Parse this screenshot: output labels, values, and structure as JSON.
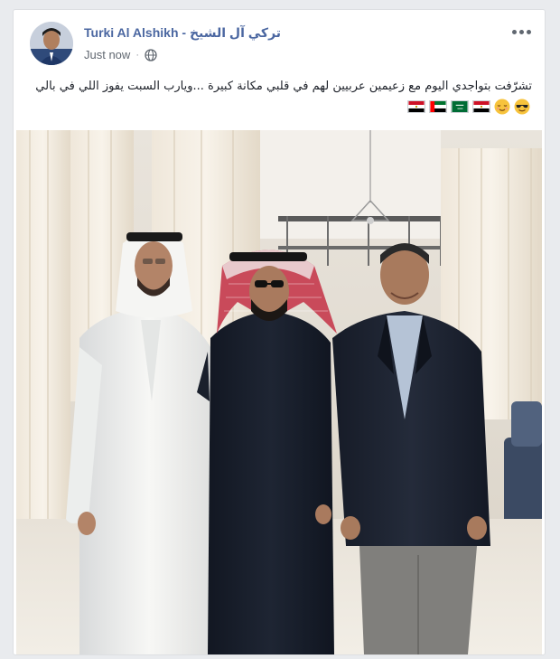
{
  "post": {
    "author": {
      "name": "Turki Al Alshikh - تركي آل الشيخ",
      "avatar": "profile-photo"
    },
    "timestamp": "Just now",
    "separator": "·",
    "privacy_icon": "globe-icon",
    "more_icon": "more-options-icon",
    "text": "تشرّفت بتواجدي اليوم مع زعيمين عربيين لهم في قلبي مكانة كبيرة ...ويارب السبت يفوز اللي في بالي",
    "emojis": [
      "sunglasses-emoji",
      "relieved-face-emoji"
    ],
    "flags": [
      "egypt-flag",
      "saudi-flag",
      "uae-flag",
      "egypt-flag"
    ],
    "photo": "group-photo-three-men-standing-indoors"
  },
  "colors": {
    "author_link": "#4b67a1",
    "meta_text": "#606770",
    "page_bg": "#e9ebee",
    "card_bg": "#ffffff"
  }
}
